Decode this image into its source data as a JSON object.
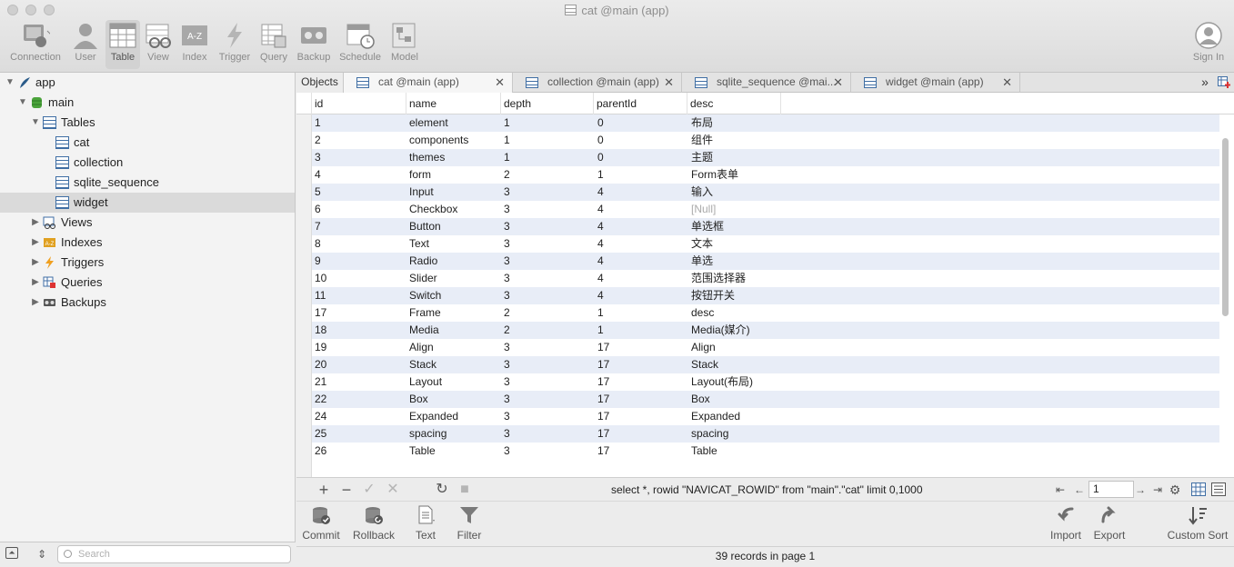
{
  "window": {
    "title": "cat @main (app)"
  },
  "toolbar": {
    "items": [
      {
        "label": "Connection",
        "icon": "connection-icon"
      },
      {
        "label": "User",
        "icon": "user-icon"
      },
      {
        "label": "Table",
        "icon": "table-icon"
      },
      {
        "label": "View",
        "icon": "view-icon"
      },
      {
        "label": "Index",
        "icon": "index-icon"
      },
      {
        "label": "Trigger",
        "icon": "trigger-icon"
      },
      {
        "label": "Query",
        "icon": "query-icon"
      },
      {
        "label": "Backup",
        "icon": "backup-icon"
      },
      {
        "label": "Schedule",
        "icon": "schedule-icon"
      },
      {
        "label": "Model",
        "icon": "model-icon"
      }
    ],
    "signin": "Sign In"
  },
  "sidebar": {
    "tree": [
      {
        "label": "app",
        "icon": "sqlite-feather-icon"
      },
      {
        "label": "main",
        "icon": "database-icon"
      },
      {
        "label": "Tables",
        "icon": "tables-icon"
      },
      {
        "label": "cat",
        "icon": "table-icon"
      },
      {
        "label": "collection",
        "icon": "table-icon"
      },
      {
        "label": "sqlite_sequence",
        "icon": "table-icon"
      },
      {
        "label": "widget",
        "icon": "table-icon"
      },
      {
        "label": "Views",
        "icon": "views-icon"
      },
      {
        "label": "Indexes",
        "icon": "indexes-icon"
      },
      {
        "label": "Triggers",
        "icon": "triggers-icon"
      },
      {
        "label": "Queries",
        "icon": "queries-icon"
      },
      {
        "label": "Backups",
        "icon": "backups-icon"
      }
    ],
    "search_placeholder": "Search"
  },
  "tabs": {
    "objects": "Objects",
    "items": [
      {
        "label": "cat @main (app)"
      },
      {
        "label": "collection @main (app)"
      },
      {
        "label": "sqlite_sequence @mai..."
      },
      {
        "label": "widget @main (app)"
      }
    ]
  },
  "grid": {
    "columns": [
      "id",
      "name",
      "depth",
      "parentId",
      "desc"
    ],
    "rows": [
      [
        "1",
        "element",
        "1",
        "0",
        "布局"
      ],
      [
        "2",
        "components",
        "1",
        "0",
        "组件"
      ],
      [
        "3",
        "themes",
        "1",
        "0",
        "主题"
      ],
      [
        "4",
        "form",
        "2",
        "1",
        "Form表单"
      ],
      [
        "5",
        "Input",
        "3",
        "4",
        "输入"
      ],
      [
        "6",
        "Checkbox",
        "3",
        "4",
        "[Null]"
      ],
      [
        "7",
        "Button",
        "3",
        "4",
        "单选框"
      ],
      [
        "8",
        "Text",
        "3",
        "4",
        "文本"
      ],
      [
        "9",
        "Radio",
        "3",
        "4",
        "单选"
      ],
      [
        "10",
        "Slider",
        "3",
        "4",
        "范围选择器"
      ],
      [
        "11",
        "Switch",
        "3",
        "4",
        "按钮开关"
      ],
      [
        "17",
        "Frame",
        "2",
        "1",
        "desc"
      ],
      [
        "18",
        "Media",
        "2",
        "1",
        "Media(媒介)"
      ],
      [
        "19",
        "Align",
        "3",
        "17",
        "Align"
      ],
      [
        "20",
        "Stack",
        "3",
        "17",
        "Stack"
      ],
      [
        "21",
        "Layout",
        "3",
        "17",
        "Layout(布局)"
      ],
      [
        "22",
        "Box",
        "3",
        "17",
        "Box"
      ],
      [
        "24",
        "Expanded",
        "3",
        "17",
        "Expanded"
      ],
      [
        "25",
        "spacing",
        "3",
        "17",
        "spacing"
      ],
      [
        "26",
        "Table",
        "3",
        "17",
        "Table"
      ]
    ]
  },
  "query": {
    "sql": "select *, rowid \"NAVICAT_ROWID\" from \"main\".\"cat\"  limit 0,1000",
    "page": "1"
  },
  "actions": {
    "commit": "Commit",
    "rollback": "Rollback",
    "text": "Text",
    "filter": "Filter",
    "import": "Import",
    "export": "Export",
    "custom_sort": "Custom Sort"
  },
  "status": {
    "records": "39 records in page 1"
  },
  "colors": {
    "accent": "#3f6ea4",
    "row_alt": "#e8edf7",
    "selected": "#dadada"
  }
}
